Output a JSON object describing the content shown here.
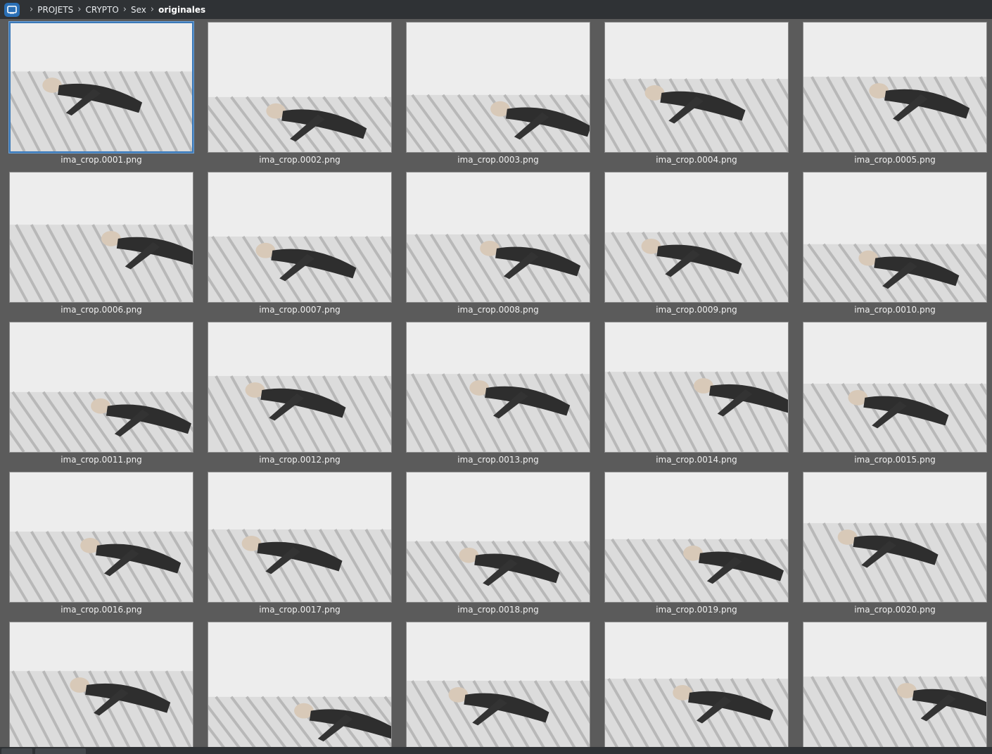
{
  "breadcrumb": {
    "home_icon": "home-icon",
    "items": [
      "PROJETS",
      "CRYPTO",
      "Sex",
      "originales"
    ]
  },
  "files": [
    "ima_crop.0001.png",
    "ima_crop.0002.png",
    "ima_crop.0003.png",
    "ima_crop.0004.png",
    "ima_crop.0005.png",
    "ima_crop.0006.png",
    "ima_crop.0007.png",
    "ima_crop.0008.png",
    "ima_crop.0009.png",
    "ima_crop.0010.png",
    "ima_crop.0011.png",
    "ima_crop.0012.png",
    "ima_crop.0013.png",
    "ima_crop.0014.png",
    "ima_crop.0015.png",
    "ima_crop.0016.png",
    "ima_crop.0017.png",
    "ima_crop.0018.png",
    "ima_crop.0019.png",
    "ima_crop.0020.png",
    "",
    "",
    "",
    "",
    ""
  ],
  "selected_index": 0,
  "colors": {
    "accent": "#3a78b8",
    "background": "#5b5b5b",
    "toolbar": "#2f3235"
  }
}
